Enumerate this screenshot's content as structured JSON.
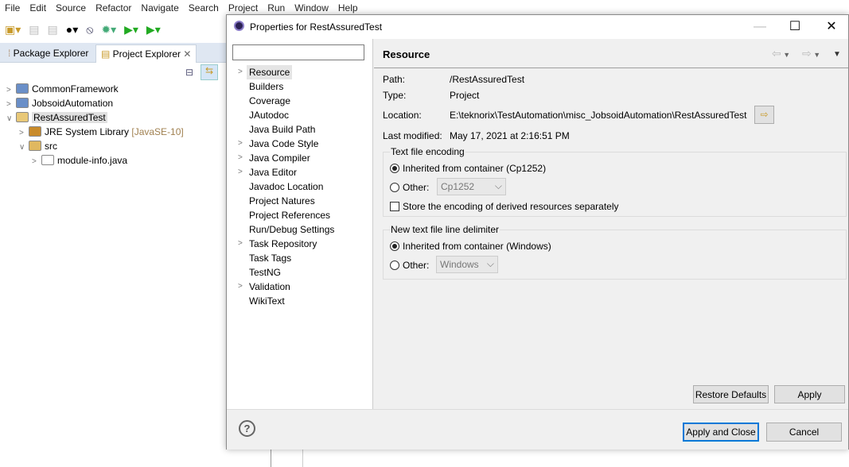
{
  "menubar": [
    "File",
    "Edit",
    "Source",
    "Refactor",
    "Navigate",
    "Search",
    "Project",
    "Run",
    "Window",
    "Help"
  ],
  "views": {
    "tabs": [
      {
        "label": "Package Explorer"
      },
      {
        "label": "Project Explorer",
        "active": true
      }
    ]
  },
  "tree": [
    {
      "label": "CommonFramework",
      "expanded": false
    },
    {
      "label": "JobsoidAutomation",
      "expanded": false
    },
    {
      "label": "RestAssuredTest",
      "expanded": true,
      "selected": true
    },
    {
      "label": "JRE System Library",
      "suffix": "[JavaSE-10]"
    },
    {
      "label": "src"
    },
    {
      "label": "module-info.java"
    }
  ],
  "dialog": {
    "title": "Properties for RestAssuredTest",
    "filter_value": "",
    "pages": [
      {
        "label": "Resource",
        "expandable": true,
        "selected": true
      },
      {
        "label": "Builders"
      },
      {
        "label": "Coverage"
      },
      {
        "label": "JAutodoc"
      },
      {
        "label": "Java Build Path"
      },
      {
        "label": "Java Code Style",
        "expandable": true
      },
      {
        "label": "Java Compiler",
        "expandable": true
      },
      {
        "label": "Java Editor",
        "expandable": true
      },
      {
        "label": "Javadoc Location"
      },
      {
        "label": "Project Natures"
      },
      {
        "label": "Project References"
      },
      {
        "label": "Run/Debug Settings"
      },
      {
        "label": "Task Repository",
        "expandable": true
      },
      {
        "label": "Task Tags"
      },
      {
        "label": "TestNG"
      },
      {
        "label": "Validation",
        "expandable": true
      },
      {
        "label": "WikiText"
      }
    ],
    "page_title": "Resource",
    "fields": {
      "path_label": "Path:",
      "path": "/RestAssuredTest",
      "type_label": "Type:",
      "type": "Project",
      "location_label": "Location:",
      "location": "E:\\teknorix\\TestAutomation\\misc_JobsoidAutomation\\RestAssuredTest",
      "modified_label": "Last modified:",
      "modified": "May 17, 2021 at 2:16:51 PM"
    },
    "encoding": {
      "title": "Text file encoding",
      "inherited": "Inherited from container (Cp1252)",
      "other": "Other:",
      "other_value": "Cp1252",
      "store_derived": "Store the encoding of derived resources separately",
      "store_checked": false
    },
    "delimiter": {
      "title": "New text file line delimiter",
      "inherited": "Inherited from container (Windows)",
      "other": "Other:",
      "other_value": "Windows"
    },
    "restore_defaults": "Restore Defaults",
    "apply": "Apply",
    "apply_close": "Apply and Close",
    "cancel": "Cancel"
  }
}
